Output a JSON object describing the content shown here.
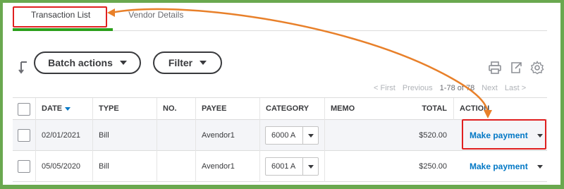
{
  "tabs": [
    {
      "label": "Transaction List",
      "active": true
    },
    {
      "label": "Vendor Details",
      "active": false
    }
  ],
  "toolbar": {
    "batch_actions_label": "Batch actions",
    "filter_label": "Filter",
    "icons": [
      "print-icon",
      "export-icon",
      "settings-gear-icon"
    ]
  },
  "pagination": {
    "first": "< First",
    "previous": "Previous",
    "range": "1-78 of 78",
    "next": "Next",
    "last": "Last >"
  },
  "table": {
    "columns": [
      "DATE",
      "TYPE",
      "NO.",
      "PAYEE",
      "CATEGORY",
      "MEMO",
      "TOTAL",
      "ACTION"
    ],
    "rows": [
      {
        "date": "02/01/2021",
        "type": "Bill",
        "no": "",
        "payee": "Avendor1",
        "category": "6000 A",
        "memo": "",
        "total": "$520.00",
        "action": "Make payment"
      },
      {
        "date": "05/05/2020",
        "type": "Bill",
        "no": "",
        "payee": "Avendor1",
        "category": "6001 A",
        "memo": "",
        "total": "$250.00",
        "action": "Make payment"
      }
    ]
  },
  "colors": {
    "frame": "#6aa84f",
    "accent_green": "#2ca01c",
    "link_blue": "#0077c5",
    "annotation_red": "#e02020",
    "annotation_arrow": "#e8802a"
  }
}
